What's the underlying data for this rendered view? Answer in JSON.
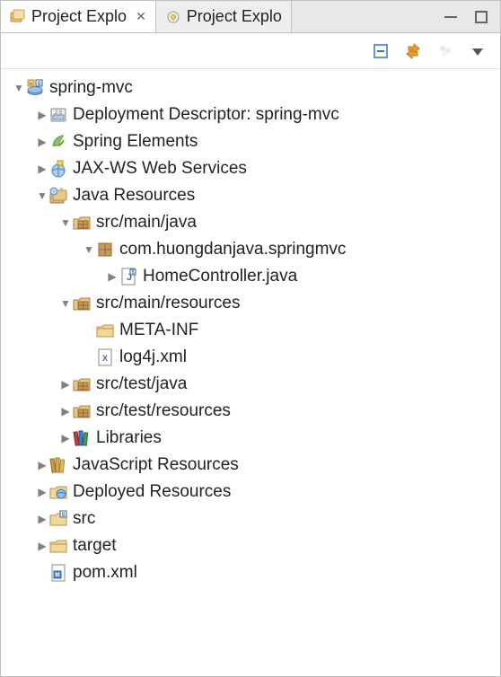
{
  "tabs": [
    {
      "label": "Project Explo",
      "active": true
    },
    {
      "label": "Project Explo",
      "active": false
    }
  ],
  "tree": [
    {
      "depth": 0,
      "arrow": "expanded",
      "icon": "maven-project",
      "label": "spring-mvc"
    },
    {
      "depth": 1,
      "arrow": "collapsed",
      "icon": "deploy-desc",
      "label": "Deployment Descriptor: spring-mvc"
    },
    {
      "depth": 1,
      "arrow": "collapsed",
      "icon": "spring-leaf",
      "label": "Spring Elements"
    },
    {
      "depth": 1,
      "arrow": "collapsed",
      "icon": "jaxws",
      "label": "JAX-WS Web Services"
    },
    {
      "depth": 1,
      "arrow": "expanded",
      "icon": "java-resources",
      "label": "Java Resources"
    },
    {
      "depth": 2,
      "arrow": "expanded",
      "icon": "pkg-folder",
      "label": "src/main/java"
    },
    {
      "depth": 3,
      "arrow": "expanded",
      "icon": "package",
      "label": "com.huongdanjava.springmvc"
    },
    {
      "depth": 4,
      "arrow": "collapsed",
      "icon": "java-file",
      "label": "HomeController.java"
    },
    {
      "depth": 2,
      "arrow": "expanded",
      "icon": "pkg-folder",
      "label": "src/main/resources"
    },
    {
      "depth": 3,
      "arrow": "none",
      "icon": "folder",
      "label": "META-INF"
    },
    {
      "depth": 3,
      "arrow": "none",
      "icon": "xml-file",
      "label": "log4j.xml"
    },
    {
      "depth": 2,
      "arrow": "collapsed",
      "icon": "pkg-folder",
      "label": "src/test/java"
    },
    {
      "depth": 2,
      "arrow": "collapsed",
      "icon": "pkg-folder",
      "label": "src/test/resources"
    },
    {
      "depth": 2,
      "arrow": "collapsed",
      "icon": "library",
      "label": "Libraries"
    },
    {
      "depth": 1,
      "arrow": "collapsed",
      "icon": "js-resources",
      "label": "JavaScript Resources"
    },
    {
      "depth": 1,
      "arrow": "collapsed",
      "icon": "deployed",
      "label": "Deployed Resources"
    },
    {
      "depth": 1,
      "arrow": "collapsed",
      "icon": "folder-s",
      "label": "src"
    },
    {
      "depth": 1,
      "arrow": "collapsed",
      "icon": "folder",
      "label": "target"
    },
    {
      "depth": 1,
      "arrow": "none",
      "icon": "pom-file",
      "label": "pom.xml"
    }
  ]
}
